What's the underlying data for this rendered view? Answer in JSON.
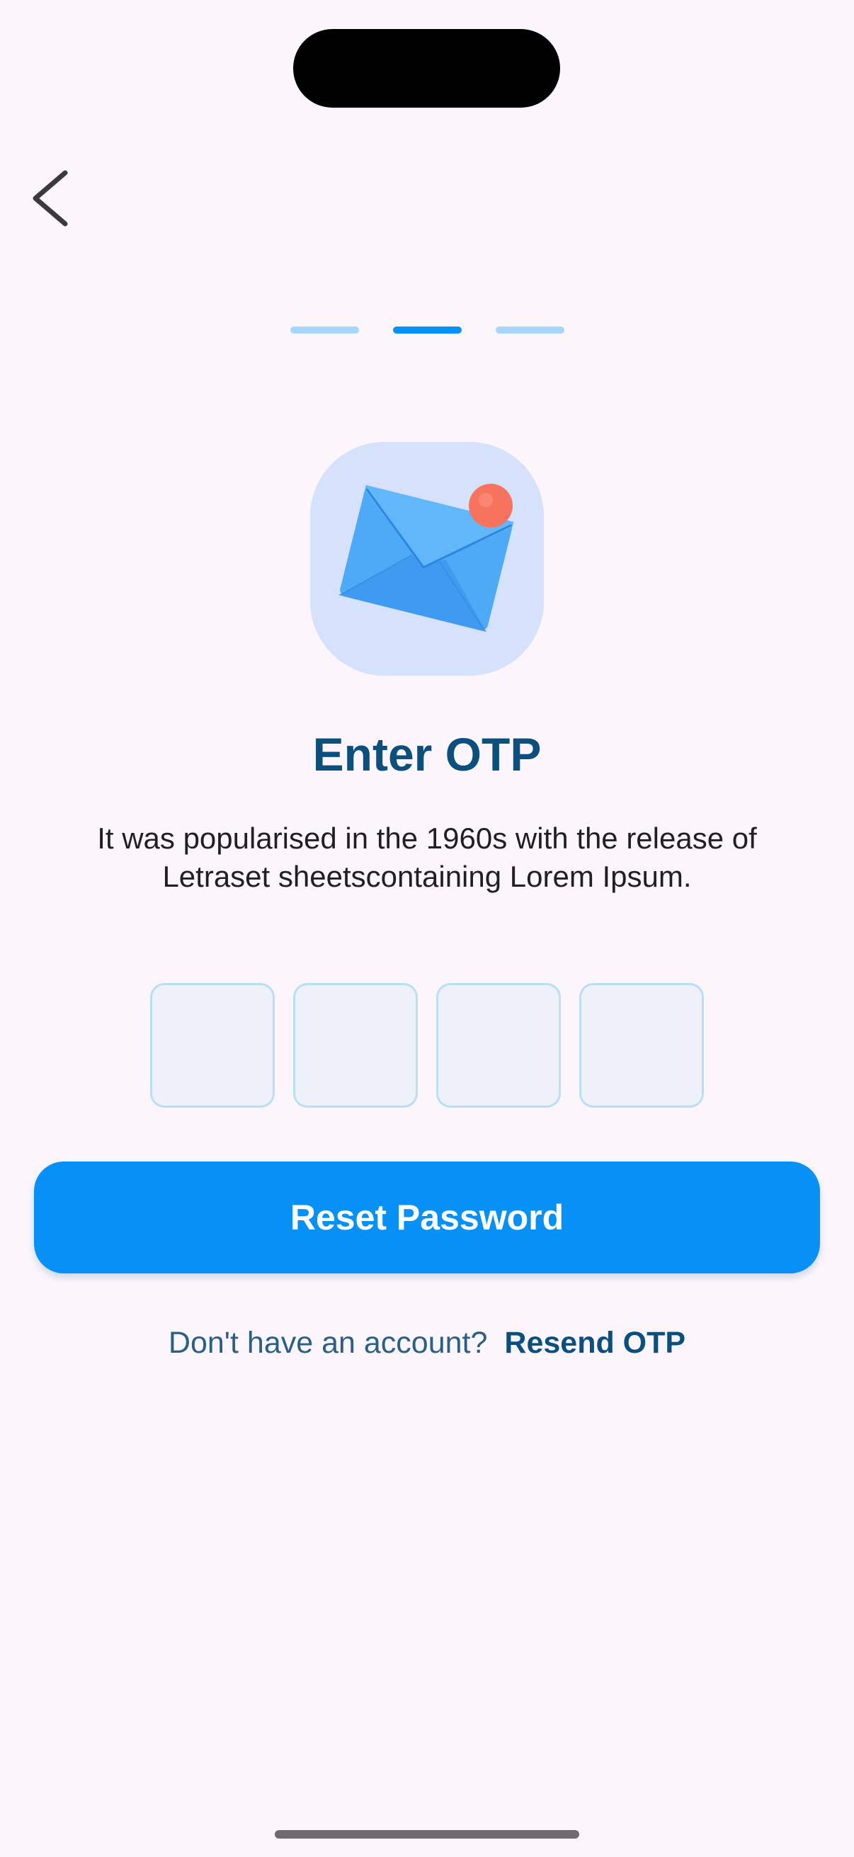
{
  "colors": {
    "background": "#fcf6fc",
    "accent": "#0791f7",
    "title": "#0b4f7f",
    "body_text": "#1f1f24",
    "step_active": "#0791f7",
    "step_inactive": "#a6d6fb",
    "illustration_bg": "#d6e2fb",
    "envelope": "#4eaaf6",
    "notification_dot": "#f7735e"
  },
  "navigation": {
    "back_icon": "chevron-left-icon"
  },
  "progress": {
    "total_steps": 3,
    "current_step": 2
  },
  "illustration": {
    "icon": "envelope-notification-icon"
  },
  "header": {
    "title": "Enter OTP",
    "subtitle": "It was popularised in the 1960s with the release of Letraset sheetscontaining Lorem Ipsum."
  },
  "otp": {
    "digits": [
      "",
      "",
      "",
      ""
    ]
  },
  "actions": {
    "primary_label": "Reset Password"
  },
  "footer": {
    "prompt": "Don't have an account?",
    "link_label": "Resend OTP"
  }
}
